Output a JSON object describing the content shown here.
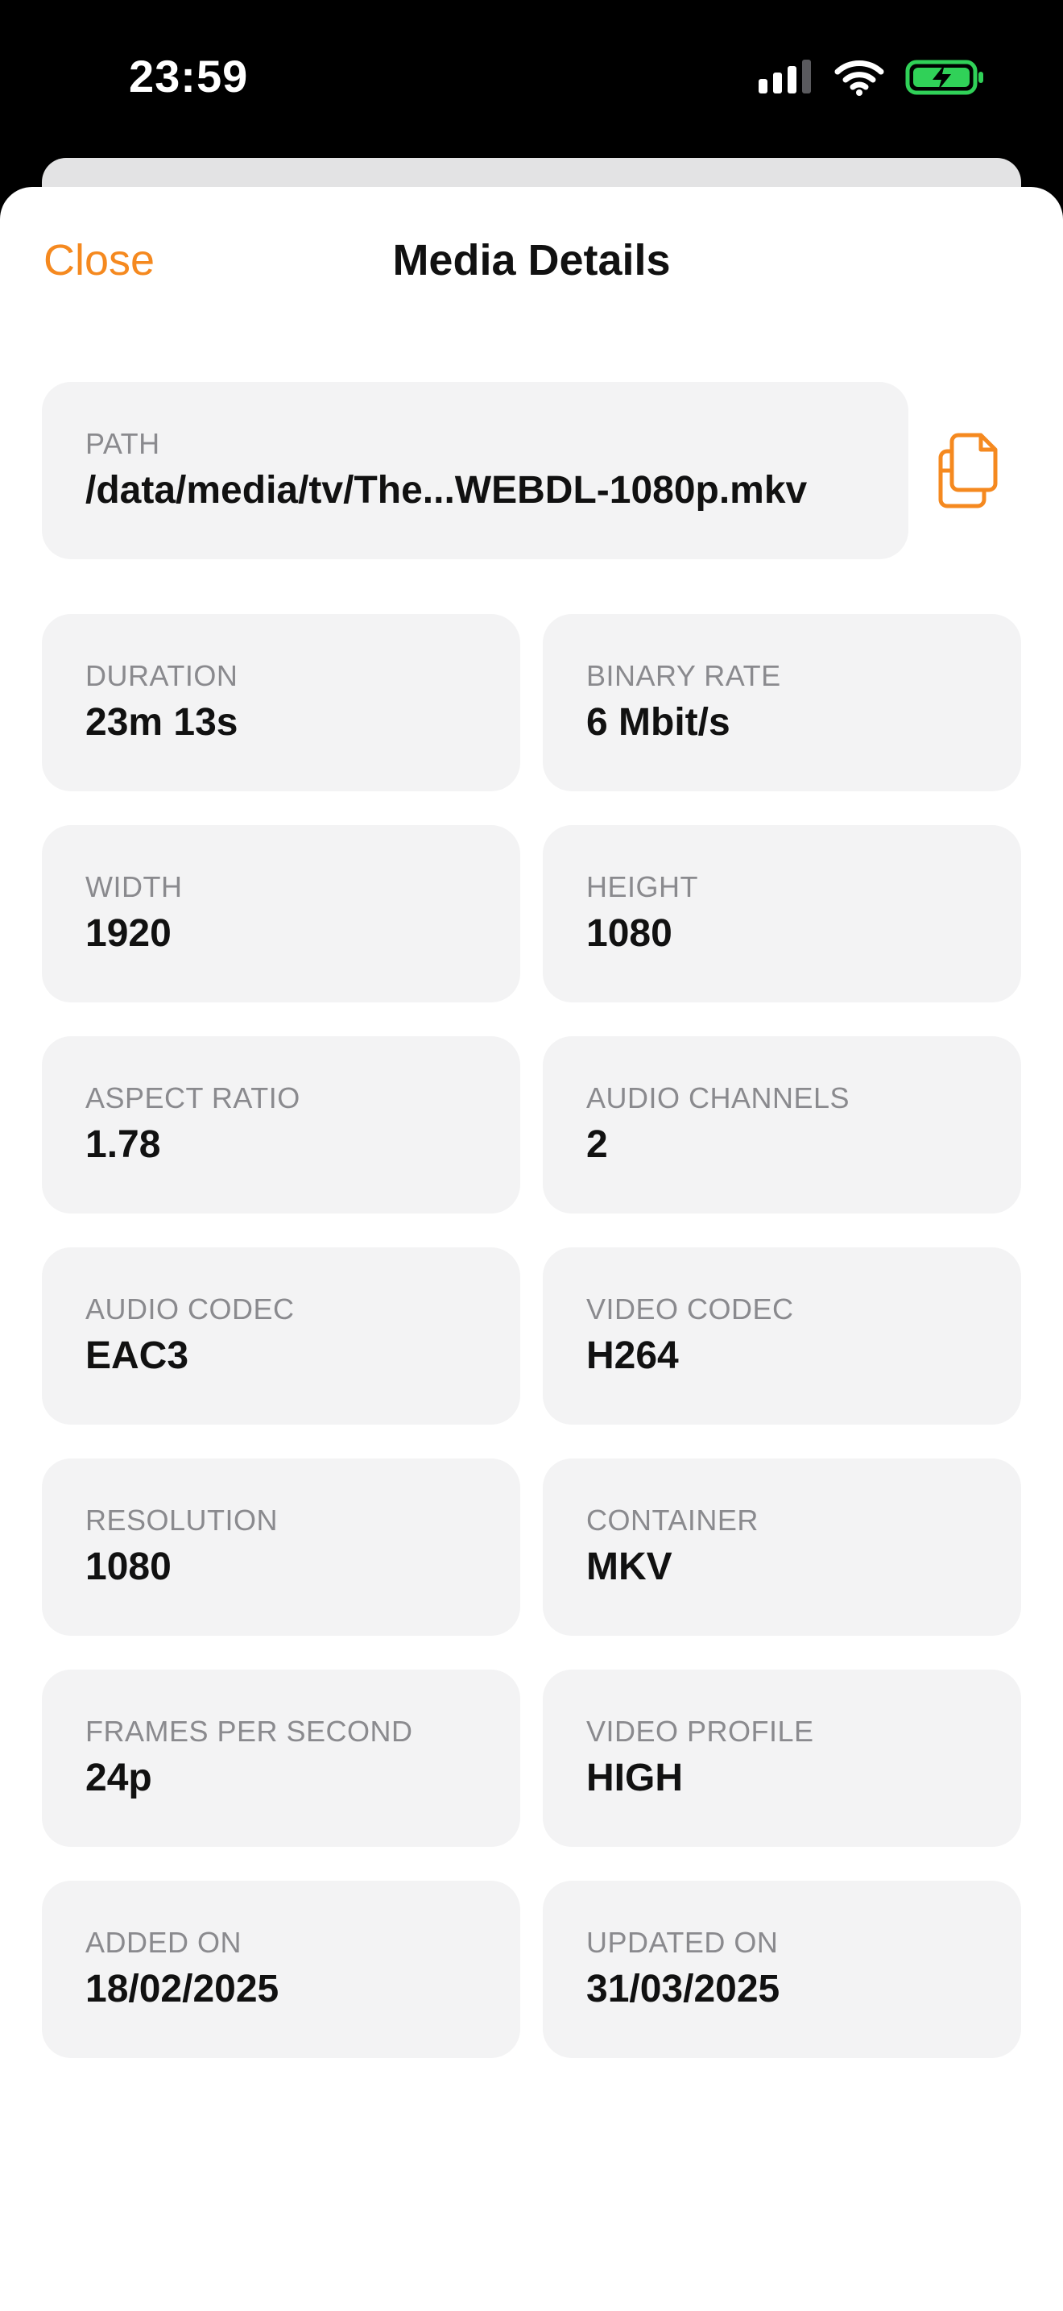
{
  "status_bar": {
    "time": "23:59",
    "icons": [
      "cellular-signal-icon",
      "wifi-icon",
      "battery-charging-icon"
    ],
    "battery_color": "#30d158"
  },
  "nav": {
    "close_label": "Close",
    "title": "Media Details"
  },
  "accent_color": "#f5891f",
  "path": {
    "label": "PATH",
    "value": "/data/media/tv/The...WEBDL-1080p.mkv",
    "copy_icon": "copy-icon"
  },
  "details": [
    {
      "key": "duration",
      "label": "DURATION",
      "value": "23m 13s"
    },
    {
      "key": "binary-rate",
      "label": "BINARY RATE",
      "value": "6 Mbit/s"
    },
    {
      "key": "width",
      "label": "WIDTH",
      "value": "1920"
    },
    {
      "key": "height",
      "label": "HEIGHT",
      "value": "1080"
    },
    {
      "key": "aspect-ratio",
      "label": "ASPECT RATIO",
      "value": "1.78"
    },
    {
      "key": "audio-channels",
      "label": "AUDIO CHANNELS",
      "value": "2"
    },
    {
      "key": "audio-codec",
      "label": "AUDIO CODEC",
      "value": "EAC3"
    },
    {
      "key": "video-codec",
      "label": "VIDEO CODEC",
      "value": "H264"
    },
    {
      "key": "resolution",
      "label": "RESOLUTION",
      "value": "1080"
    },
    {
      "key": "container",
      "label": "CONTAINER",
      "value": "MKV"
    },
    {
      "key": "frames-per-second",
      "label": "FRAMES PER SECOND",
      "value": "24p"
    },
    {
      "key": "video-profile",
      "label": "VIDEO PROFILE",
      "value": "HIGH"
    },
    {
      "key": "added-on",
      "label": "ADDED ON",
      "value": "18/02/2025"
    },
    {
      "key": "updated-on",
      "label": "UPDATED ON",
      "value": "31/03/2025"
    }
  ]
}
